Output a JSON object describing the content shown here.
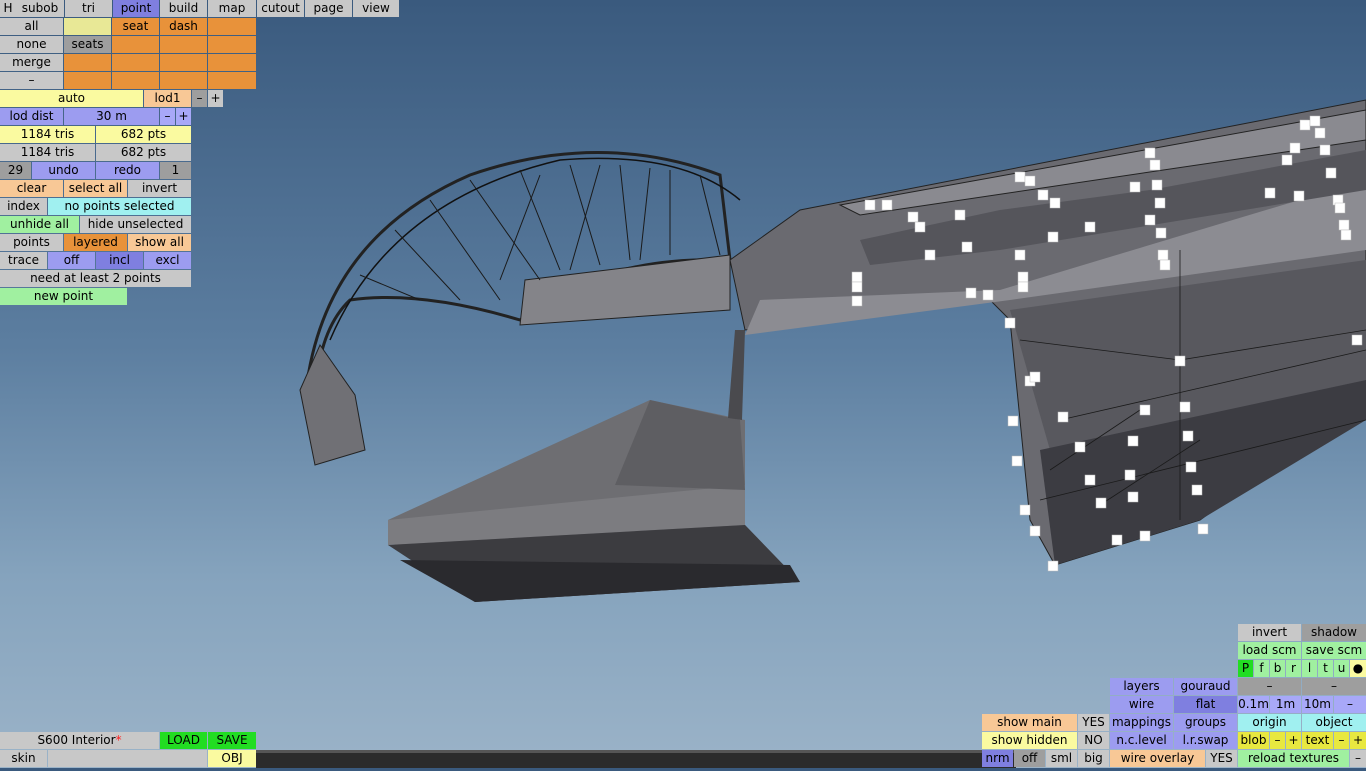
{
  "menu": {
    "h": "H",
    "tabs": [
      "subob",
      "tri",
      "point",
      "build",
      "map",
      "cutout",
      "page",
      "view"
    ]
  },
  "subob": {
    "all": "all",
    "none": "none",
    "merge": "merge",
    "dash_btn": "–",
    "seat": "seat",
    "dash": "dash",
    "seats": "seats"
  },
  "lod": {
    "auto": "auto",
    "lod1": "lod1",
    "minus": "–",
    "plus": "+",
    "dist_label": "lod dist",
    "dist_value": "30 m",
    "tris1": "1184 tris",
    "pts1": "682 pts",
    "tris2": "1184 tris",
    "pts2": "682 pts"
  },
  "history": {
    "count": "29",
    "undo": "undo",
    "redo": "redo",
    "step": "1"
  },
  "point_tools": {
    "clear": "clear",
    "select_all": "select all",
    "invert": "invert",
    "index": "index",
    "status": "no points selected",
    "unhide_all": "unhide all",
    "hide_unselected": "hide unselected",
    "points": "points",
    "layered": "layered",
    "show_all": "show all",
    "trace": "trace",
    "off": "off",
    "incl": "incl",
    "excl": "excl",
    "need": "need at least 2 points",
    "new_point": "new point"
  },
  "bottom_left": {
    "model_name": "S600 Interior",
    "modified_mark": "*",
    "load": "LOAD",
    "save": "SAVE",
    "skin": "skin",
    "skin_value": "",
    "obj": "OBJ"
  },
  "bottom_right": {
    "invert": "invert",
    "shadow": "shadow",
    "load_scm": "load scm",
    "save_scm": "save scm",
    "flags": [
      "P",
      "f",
      "b",
      "r",
      "l",
      "t",
      "u",
      "●"
    ],
    "layers": "layers",
    "gouraud": "gouraud",
    "minus1": "–",
    "minus2": "–",
    "wire": "wire",
    "flat": "flat",
    "d01": "0.1m",
    "d1": "1m",
    "d10": "10m",
    "dminus": "–",
    "show_main": "show main",
    "show_main_val": "YES",
    "mappings": "mappings",
    "groups": "groups",
    "origin": "origin",
    "object": "object",
    "show_hidden": "show hidden",
    "show_hidden_val": "NO",
    "nclevel": "n.c.level",
    "lrswap": "l.r.swap",
    "blob": "blob",
    "blob_minus": "–",
    "blob_plus": "+",
    "text": "text",
    "text_minus": "–",
    "text_plus": "+",
    "nrm": "nrm",
    "off": "off",
    "sml": "sml",
    "big": "big",
    "wire_overlay": "wire overlay",
    "wire_overlay_val": "YES",
    "reload_textures": "reload textures",
    "last_minus": "–"
  }
}
